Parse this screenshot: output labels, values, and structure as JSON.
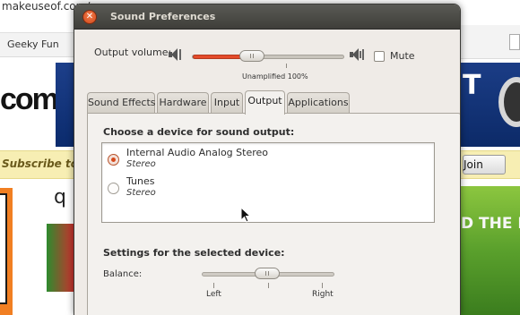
{
  "background_page": {
    "url": "makeuseof.com/",
    "nav_item": "Geeky Fun",
    "logo_text": "com",
    "subscribe_text": "Subscribe to",
    "join_button": "Join",
    "banner_text": "D THE RI"
  },
  "window": {
    "title": "Sound Preferences",
    "output_volume_label": "Output volume:",
    "volume_level_percent": 38,
    "unamplified_label": "Unamplified 100%",
    "mute_label": "Mute",
    "mute_checked": false,
    "tabs": [
      {
        "label": "Sound Effects",
        "active": false
      },
      {
        "label": "Hardware",
        "active": false
      },
      {
        "label": "Input",
        "active": false
      },
      {
        "label": "Output",
        "active": true
      },
      {
        "label": "Applications",
        "active": false
      }
    ],
    "choose_device_heading": "Choose a device for sound output:",
    "devices": [
      {
        "name": "Internal Audio Analog Stereo",
        "profile": "Stereo",
        "selected": true
      },
      {
        "name": "Tunes",
        "profile": "Stereo",
        "selected": false
      }
    ],
    "settings_heading": "Settings for the selected device:",
    "balance_label": "Balance:",
    "balance_left_label": "Left",
    "balance_right_label": "Right",
    "balance_value": 0
  },
  "colors": {
    "accent": "#e44b2a",
    "titlebar": "#4a4945",
    "window_bg": "#efebe7"
  }
}
